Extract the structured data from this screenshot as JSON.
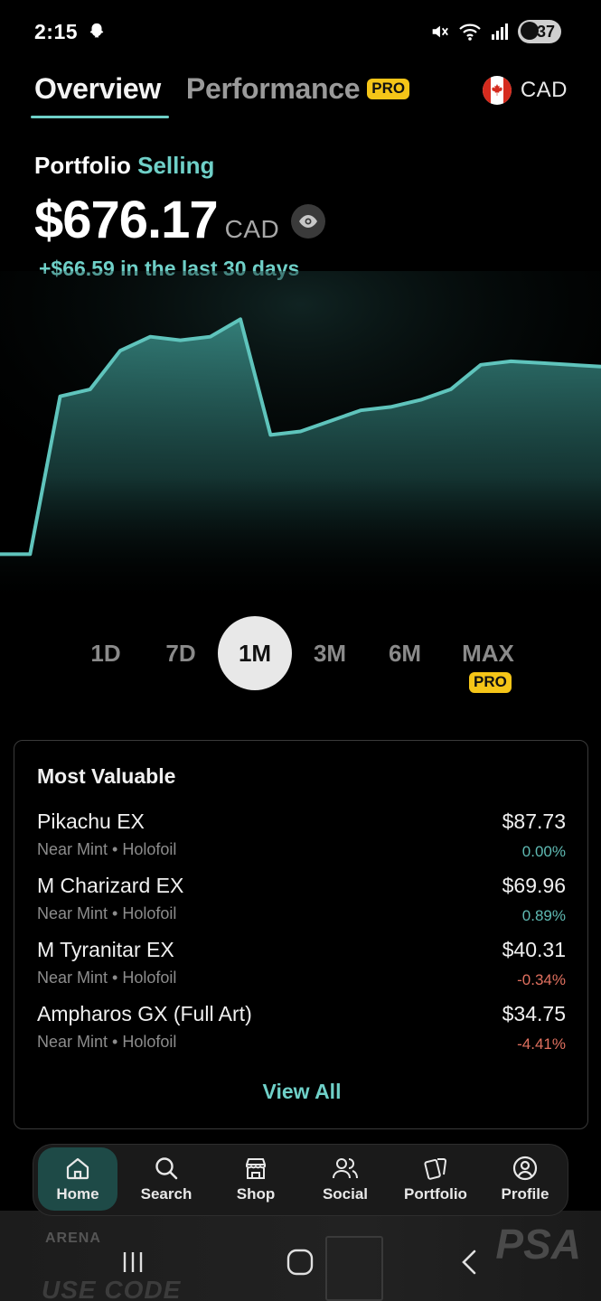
{
  "status_bar": {
    "time": "2:15",
    "battery": "37",
    "icons": [
      "snapchat-ghost-icon",
      "mute-icon",
      "wifi-icon",
      "signal-icon",
      "battery-charging-icon"
    ]
  },
  "header": {
    "tabs": [
      {
        "label": "Overview",
        "active": true
      },
      {
        "label": "Performance",
        "badge": "PRO"
      }
    ],
    "currency": {
      "code": "CAD",
      "flag_icon": "canada-flag-icon"
    }
  },
  "portfolio": {
    "title": "Portfolio",
    "mode": "Selling",
    "value": "$676.17",
    "currency": "CAD",
    "change_text": "+$66.59 in the last 30 days",
    "accent_color": "#6fd0c8"
  },
  "chart_data": {
    "type": "area",
    "title": "",
    "xlabel": "",
    "ylabel": "",
    "ylim": [
      600,
      685
    ],
    "x": [
      0,
      1,
      2,
      3,
      4,
      5,
      6,
      7,
      8,
      9,
      10,
      11,
      12,
      13,
      14,
      15,
      16,
      17,
      18,
      19,
      20
    ],
    "series": [
      {
        "values": [
          612,
          612,
          657,
          659,
          670,
          674,
          673,
          674,
          679,
          646,
          647,
          650,
          653,
          654,
          656,
          659,
          666,
          667,
          666.5,
          666,
          665.5
        ],
        "color": "#5fc4bc"
      }
    ],
    "grid": false
  },
  "ranges": {
    "options": [
      "1D",
      "7D",
      "1M",
      "3M",
      "6M",
      "MAX"
    ],
    "selected": "1M",
    "max_badge": "PRO"
  },
  "most_valuable": {
    "title": "Most Valuable",
    "items": [
      {
        "name": "Pikachu EX",
        "condition": "Near Mint • Holofoil",
        "price": "$87.73",
        "change": "0.00%",
        "trend": "pos"
      },
      {
        "name": "M Charizard EX",
        "condition": "Near Mint • Holofoil",
        "price": "$69.96",
        "change": "0.89%",
        "trend": "pos"
      },
      {
        "name": "M Tyranitar EX",
        "condition": "Near Mint • Holofoil",
        "price": "$40.31",
        "change": "-0.34%",
        "trend": "neg"
      },
      {
        "name": "Ampharos GX (Full Art)",
        "condition": "Near Mint • Holofoil",
        "price": "$34.75",
        "change": "-4.41%",
        "trend": "neg"
      }
    ],
    "view_all": "View All"
  },
  "nav": {
    "items": [
      {
        "label": "Home",
        "icon": "home-icon",
        "active": true
      },
      {
        "label": "Search",
        "icon": "search-icon"
      },
      {
        "label": "Shop",
        "icon": "shop-icon"
      },
      {
        "label": "Social",
        "icon": "social-icon"
      },
      {
        "label": "Portfolio",
        "icon": "cards-icon"
      },
      {
        "label": "Profile",
        "icon": "profile-icon"
      }
    ]
  },
  "banner": {
    "brand": "ARENA",
    "code_text": "USE CODE",
    "partner": "PSA"
  }
}
